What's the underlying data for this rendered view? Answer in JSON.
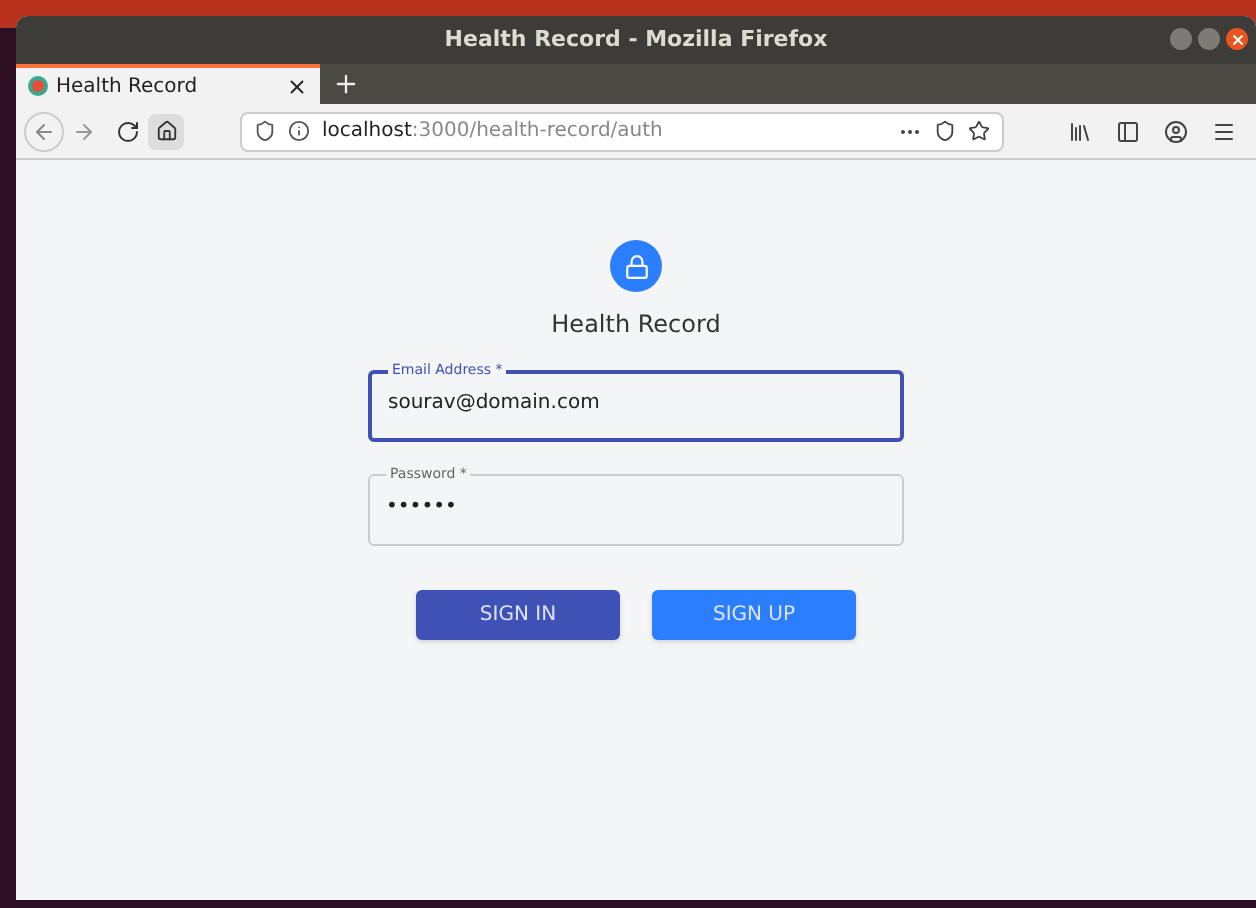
{
  "window": {
    "title": "Health Record - Mozilla Firefox"
  },
  "tabs": [
    {
      "label": "Health Record",
      "selected": true
    }
  ],
  "address_bar": {
    "host": "localhost",
    "path": ":3000/health-record/auth"
  },
  "app": {
    "title": "Health Record"
  },
  "fields": [
    {
      "label": "Email Address *",
      "value": "sourav@domain.com",
      "focused": true
    },
    {
      "label": "Password *",
      "value": "••••••",
      "focused": false
    }
  ],
  "buttons": [
    {
      "label": "SIGN IN",
      "kind": "primary"
    },
    {
      "label": "SIGN UP",
      "kind": "secondary"
    }
  ]
}
